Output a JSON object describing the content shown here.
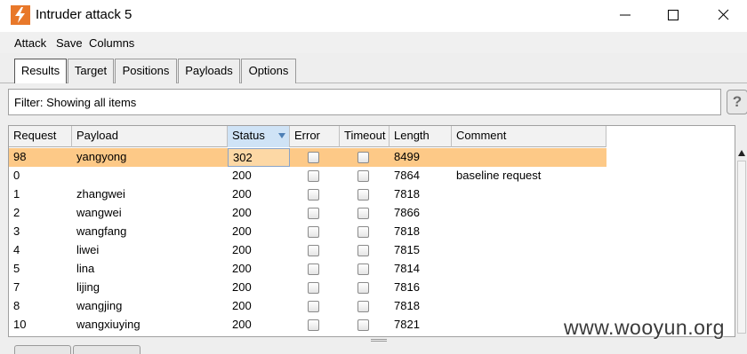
{
  "window": {
    "title": "Intruder attack 5",
    "icon": "burp-lightning-icon",
    "accent": "#e8782a"
  },
  "menu": {
    "items": [
      "Attack",
      "Save",
      "Columns"
    ]
  },
  "tabs": {
    "items": [
      "Results",
      "Target",
      "Positions",
      "Payloads",
      "Options"
    ],
    "active": "Results"
  },
  "filter": {
    "text": "Filter: Showing all items",
    "help_label": "?"
  },
  "table": {
    "columns": [
      "Request",
      "Payload",
      "Status",
      "Error",
      "Timeout",
      "Length",
      "Comment"
    ],
    "sorted_column": "Status",
    "selected_row_color": "#fdc987",
    "rows": [
      {
        "request": "98",
        "payload": "yangyong",
        "status": "302",
        "length": "8499",
        "comment": "",
        "selected": true
      },
      {
        "request": "0",
        "payload": "",
        "status": "200",
        "length": "7864",
        "comment": "baseline request",
        "selected": false
      },
      {
        "request": "1",
        "payload": "zhangwei",
        "status": "200",
        "length": "7818",
        "comment": "",
        "selected": false
      },
      {
        "request": "2",
        "payload": "wangwei",
        "status": "200",
        "length": "7866",
        "comment": "",
        "selected": false
      },
      {
        "request": "3",
        "payload": "wangfang",
        "status": "200",
        "length": "7818",
        "comment": "",
        "selected": false
      },
      {
        "request": "4",
        "payload": "liwei",
        "status": "200",
        "length": "7815",
        "comment": "",
        "selected": false
      },
      {
        "request": "5",
        "payload": "lina",
        "status": "200",
        "length": "7814",
        "comment": "",
        "selected": false
      },
      {
        "request": "7",
        "payload": "lijing",
        "status": "200",
        "length": "7816",
        "comment": "",
        "selected": false
      },
      {
        "request": "8",
        "payload": "wangjing",
        "status": "200",
        "length": "7818",
        "comment": "",
        "selected": false
      },
      {
        "request": "10",
        "payload": "wangxiuying",
        "status": "200",
        "length": "7821",
        "comment": "",
        "selected": false
      }
    ]
  },
  "watermark": "www.wooyun.org"
}
